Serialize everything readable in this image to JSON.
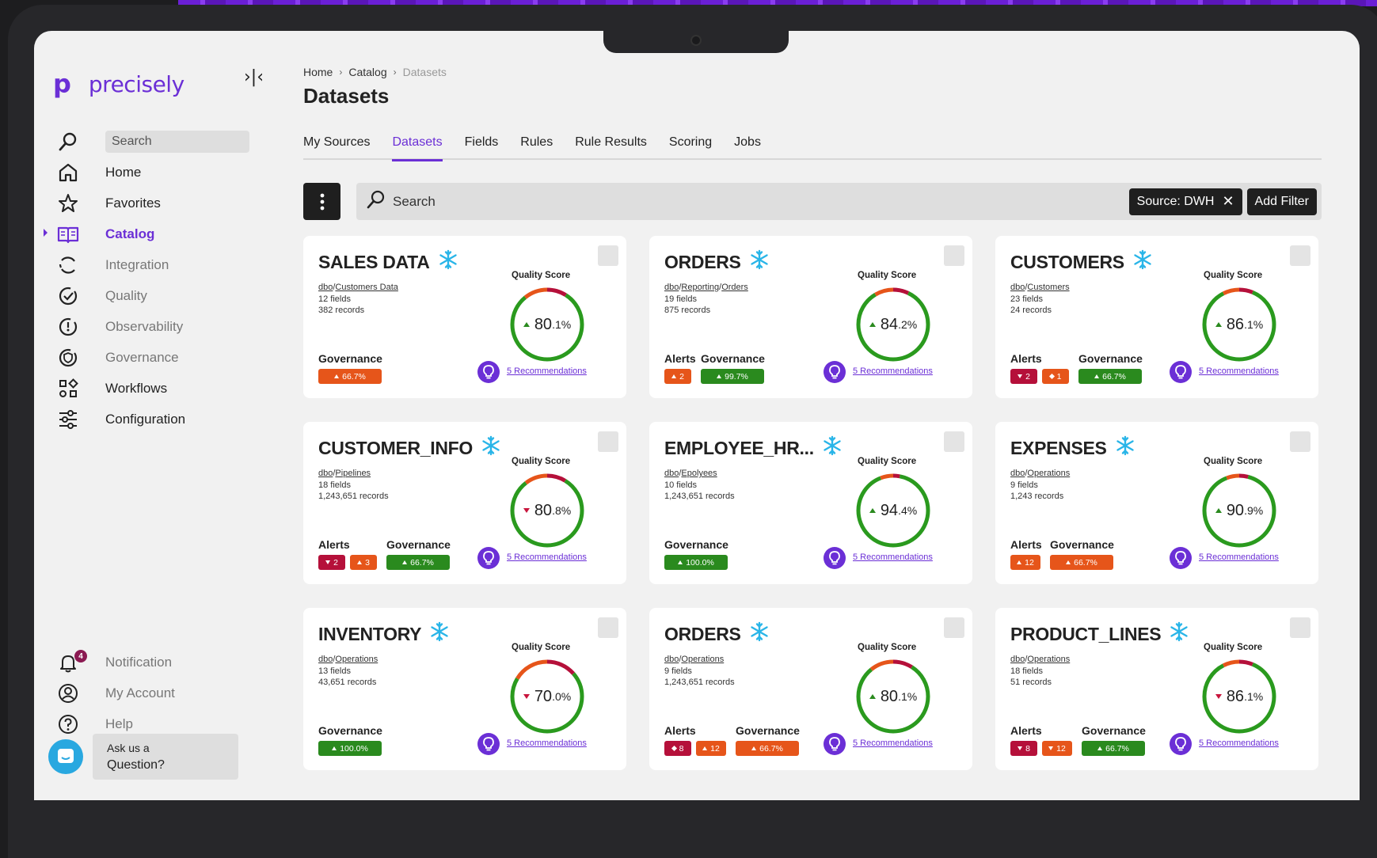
{
  "brand": {
    "name": "precisely",
    "mark": "p",
    "accent": "#6b2fd6"
  },
  "sidebar": {
    "search_placeholder": "Search",
    "items": [
      {
        "label": "Home",
        "icon": "home-icon"
      },
      {
        "label": "Favorites",
        "icon": "star-icon"
      },
      {
        "label": "Catalog",
        "icon": "book-icon",
        "active": true
      },
      {
        "label": "Integration",
        "icon": "integration-icon"
      },
      {
        "label": "Quality",
        "icon": "quality-icon"
      },
      {
        "label": "Observability",
        "icon": "observability-icon"
      },
      {
        "label": "Governance",
        "icon": "governance-icon"
      },
      {
        "label": "Workflows",
        "icon": "workflows-icon"
      },
      {
        "label": "Configuration",
        "icon": "sliders-icon"
      }
    ],
    "bottom": [
      {
        "label": "Notification",
        "icon": "bell-icon",
        "badge": "4"
      },
      {
        "label": "My Account",
        "icon": "user-icon"
      },
      {
        "label": "Help",
        "icon": "help-icon"
      }
    ],
    "ask": {
      "line1": "Ask us a",
      "line2": "Question?"
    }
  },
  "breadcrumb": [
    "Home",
    "Catalog",
    "Datasets"
  ],
  "page_title": "Datasets",
  "tabs": [
    "My Sources",
    "Datasets",
    "Fields",
    "Rules",
    "Rule Results",
    "Scoring",
    "Jobs"
  ],
  "active_tab": "Datasets",
  "toolbar": {
    "search_placeholder": "Search",
    "filter_chip": "Source: DWH",
    "add_filter": "Add Filter"
  },
  "labels": {
    "quality_score": "Quality Score",
    "alerts": "Alerts",
    "governance": "Governance"
  },
  "cards": [
    {
      "title": "SALES DATA",
      "path_a": "dbo",
      "path_b": "Customers Data",
      "fields": "12 fields",
      "records": "382 records",
      "score_int": "80",
      "score_dec": ".1%",
      "trend": "up",
      "score": 80.1,
      "alerts": [],
      "governance": {
        "value": "66.7%",
        "color": "orange",
        "trend": "up"
      },
      "recommendations": "5 Recommendations"
    },
    {
      "title": "ORDERS",
      "path_a": "dbo",
      "path_b": "Reporting",
      "path_c": "Orders",
      "fields": "19 fields",
      "records": "875 records",
      "score_int": "84",
      "score_dec": ".2%",
      "trend": "up",
      "score": 84.2,
      "alerts": [
        {
          "value": "2",
          "color": "orange",
          "sym": "up"
        }
      ],
      "governance": {
        "value": "99.7%",
        "color": "green",
        "trend": "up"
      },
      "recommendations": "5 Recommendations"
    },
    {
      "title": "CUSTOMERS",
      "path_a": "dbo",
      "path_b": "Customers",
      "fields": "23 fields",
      "records": "24 records",
      "score_int": "86",
      "score_dec": ".1%",
      "trend": "up",
      "score": 86.1,
      "alerts": [
        {
          "value": "2",
          "color": "maroon",
          "sym": "down"
        },
        {
          "value": "1",
          "color": "orange",
          "sym": "diamond"
        }
      ],
      "governance": {
        "value": "66.7%",
        "color": "green",
        "trend": "up"
      },
      "recommendations": "5 Recommendations"
    },
    {
      "title": "CUSTOMER_INFO",
      "path_a": "dbo",
      "path_b": "Pipelines",
      "fields": "18 fields",
      "records": "1,243,651 records",
      "score_int": "80",
      "score_dec": ".8%",
      "trend": "down",
      "score": 80.8,
      "alerts": [
        {
          "value": "2",
          "color": "maroon",
          "sym": "down"
        },
        {
          "value": "3",
          "color": "orange",
          "sym": "up"
        }
      ],
      "governance": {
        "value": "66.7%",
        "color": "green",
        "trend": "up"
      },
      "recommendations": "5 Recommendations"
    },
    {
      "title": "EMPLOYEE_HR...",
      "path_a": "dbo",
      "path_b": "Epolyees",
      "fields": "10 fields",
      "records": "1,243,651 records",
      "score_int": "94",
      "score_dec": ".4%",
      "trend": "up",
      "score": 94.4,
      "alerts": [],
      "governance": {
        "value": "100.0%",
        "color": "green",
        "trend": "up"
      },
      "recommendations": "5 Recommendations"
    },
    {
      "title": "EXPENSES",
      "path_a": "dbo",
      "path_b": "Operations",
      "fields": "9 fields",
      "records": "1,243 records",
      "score_int": "90",
      "score_dec": ".9%",
      "trend": "up",
      "score": 90.9,
      "alerts": [
        {
          "value": "12",
          "color": "orange",
          "sym": "up"
        }
      ],
      "governance": {
        "value": "66.7%",
        "color": "orange",
        "trend": "up"
      },
      "recommendations": "5 Recommendations"
    },
    {
      "title": "INVENTORY",
      "path_a": "dbo",
      "path_b": "Operations",
      "fields": "13 fields",
      "records": "43,651 records",
      "score_int": "70",
      "score_dec": ".0%",
      "trend": "down",
      "score": 70.0,
      "alerts": [],
      "governance": {
        "value": "100.0%",
        "color": "green",
        "trend": "up"
      },
      "recommendations": "5 Recommendations"
    },
    {
      "title": "ORDERS",
      "path_a": "dbo",
      "path_b": "Operations",
      "fields": "9 fields",
      "records": "1,243,651 records",
      "score_int": "80",
      "score_dec": ".1%",
      "trend": "up",
      "score": 80.1,
      "alerts": [
        {
          "value": "8",
          "color": "maroon",
          "sym": "diamond"
        },
        {
          "value": "12",
          "color": "orange",
          "sym": "up"
        }
      ],
      "governance": {
        "value": "66.7%",
        "color": "orange",
        "trend": "up"
      },
      "recommendations": "5 Recommendations"
    },
    {
      "title": "PRODUCT_LINES",
      "path_a": "dbo",
      "path_b": "Operations",
      "fields": "18 fields",
      "records": "51 records",
      "score_int": "86",
      "score_dec": ".1%",
      "trend": "down",
      "score": 86.1,
      "alerts": [
        {
          "value": "8",
          "color": "maroon",
          "sym": "down"
        },
        {
          "value": "12",
          "color": "orange",
          "sym": "down"
        }
      ],
      "governance": {
        "value": "66.7%",
        "color": "green",
        "trend": "up"
      },
      "recommendations": "5 Recommendations"
    }
  ]
}
